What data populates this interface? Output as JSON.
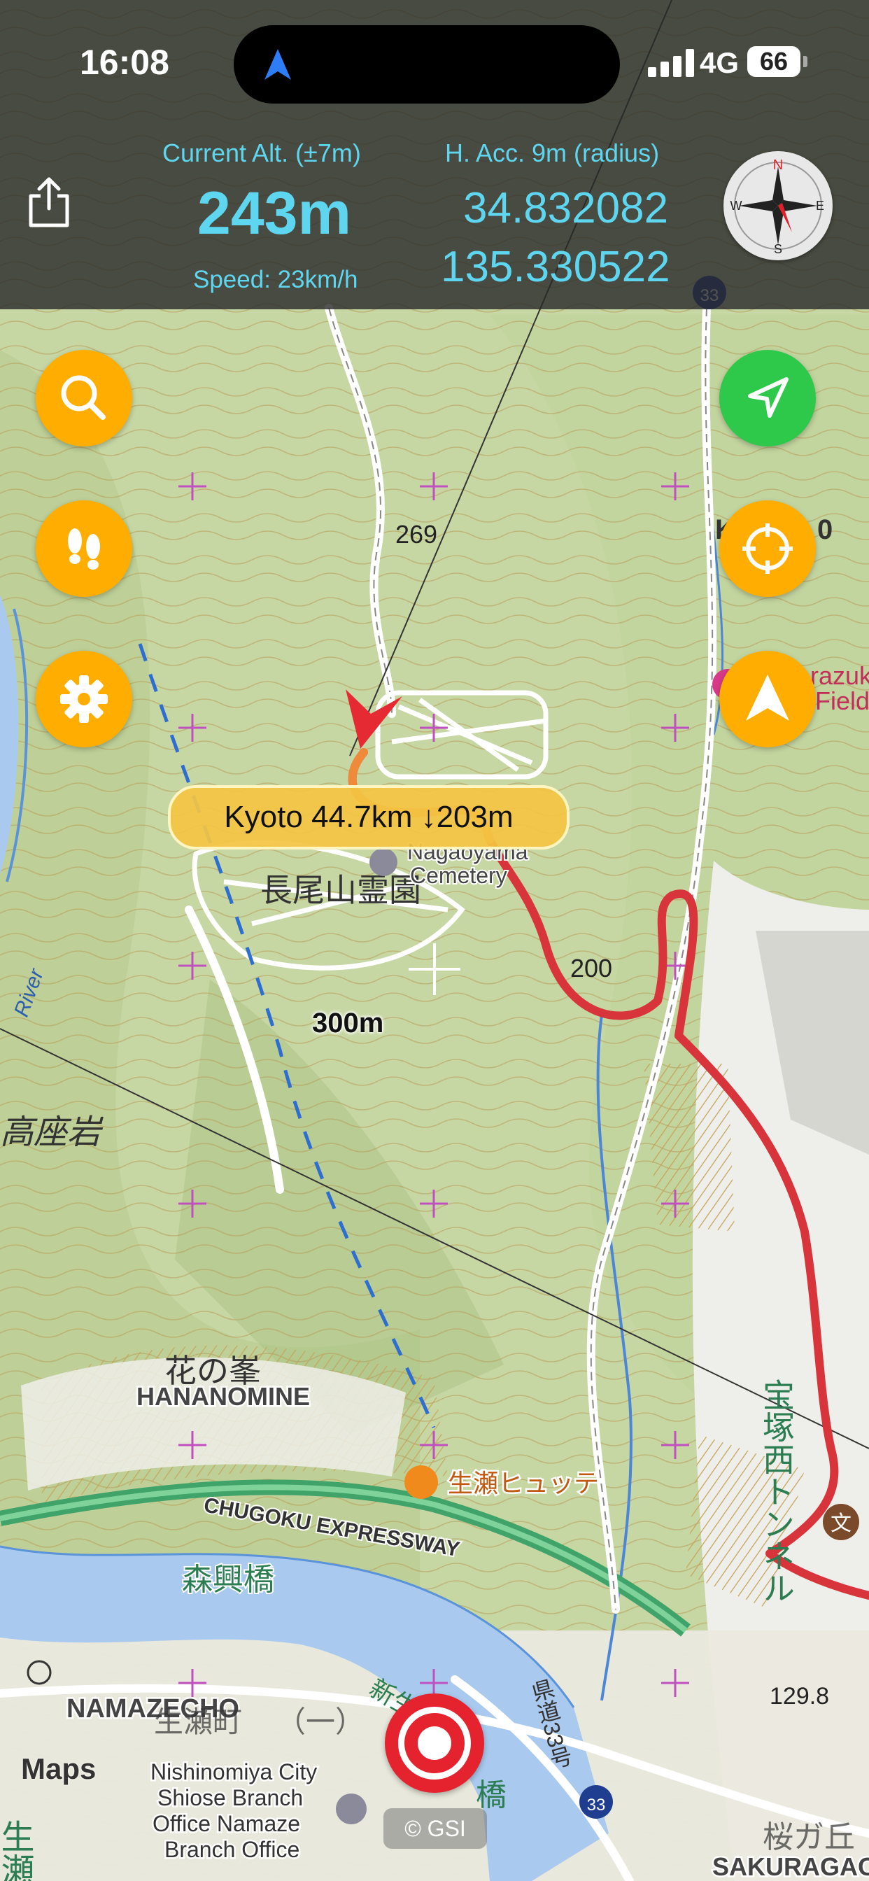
{
  "status_bar": {
    "time": "16:08",
    "network": "4G",
    "battery": "66"
  },
  "header": {
    "altitude_label": "Current Alt. (±7m)",
    "altitude_value": "243m",
    "speed": "Speed: 23km/h",
    "accuracy_label": "H. Acc. 9m (radius)",
    "latitude": "34.832082",
    "longitude": "135.330522",
    "compass_letters": {
      "n": "N",
      "e": "E",
      "s": "S",
      "w": "W"
    }
  },
  "left_buttons": [
    {
      "icon": "search-icon"
    },
    {
      "icon": "footprints-icon"
    },
    {
      "icon": "gear-icon"
    }
  ],
  "right_buttons": [
    {
      "icon": "location-arrow-icon",
      "color": "#2ec84a"
    },
    {
      "icon": "target-icon",
      "color": "#ffad00"
    },
    {
      "icon": "navigation-arrow-icon",
      "color": "#ffad00"
    }
  ],
  "destination_label": "Kyoto 44.7km ↓203m",
  "scale_label": "300m",
  "attribution": "© GSI",
  "maps_logo": "Maps",
  "map_labels": {
    "elev_269": "269",
    "elev_200": "200",
    "elev_129": "129.8",
    "cemetery_jp": "長尾山霊園",
    "cemetery_en_1": "Nagaoyama",
    "cemetery_en_2": "Cemetery",
    "rock": "高座岩",
    "hananomine_jp": "花の峯",
    "hananomine_en": "HANANOMINE",
    "hut": "生瀬ヒュッテ",
    "expressway": "CHUGOKU EXPRESSWAY",
    "bridge": "森興橋",
    "namazecho": "NAMAZECHO",
    "namaze_jp": "生瀬町",
    "office_1": "Nishinomiya City",
    "office_2": "Shiose Branch",
    "office_3": "Office Namaze",
    "office_4": "Branch Office",
    "station": "生瀬駅",
    "tunnel": "宝塚西トンネル",
    "prefroad": "県道33号",
    "route": "33",
    "sakuragaoka": "SAKURAGAO",
    "river": "River",
    "field_1": "razuk",
    "field_2": "Field",
    "kabuto": "K",
    "kabuto2": "0",
    "shinsei": "新生",
    "hashi": "橋",
    "ichi": "（一）",
    "sakura_jp": "桜ガ丘",
    "shu": "文"
  },
  "colors": {
    "route_red": "#d8343c",
    "accent_orange": "#ffad00",
    "accent_green": "#2ec84a",
    "readout_cyan": "#5fd6f0"
  }
}
